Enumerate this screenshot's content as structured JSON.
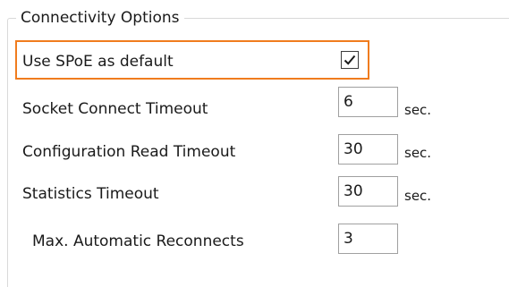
{
  "group": {
    "title": "Connectivity Options"
  },
  "use_spoe": {
    "label": "Use SPoE as default",
    "checked": true
  },
  "socket_timeout": {
    "label": "Socket Connect Timeout",
    "value": "6",
    "unit": "sec."
  },
  "config_timeout": {
    "label": "Configuration Read Timeout",
    "value": "30",
    "unit": "sec."
  },
  "stats_timeout": {
    "label": "Statistics Timeout",
    "value": "30",
    "unit": "sec."
  },
  "reconnects": {
    "label": "Max. Automatic Reconnects",
    "value": "3"
  },
  "colors": {
    "highlight_border": "#f07c1e",
    "field_border": "#a0a0a0",
    "group_border": "#d9d9d9"
  }
}
